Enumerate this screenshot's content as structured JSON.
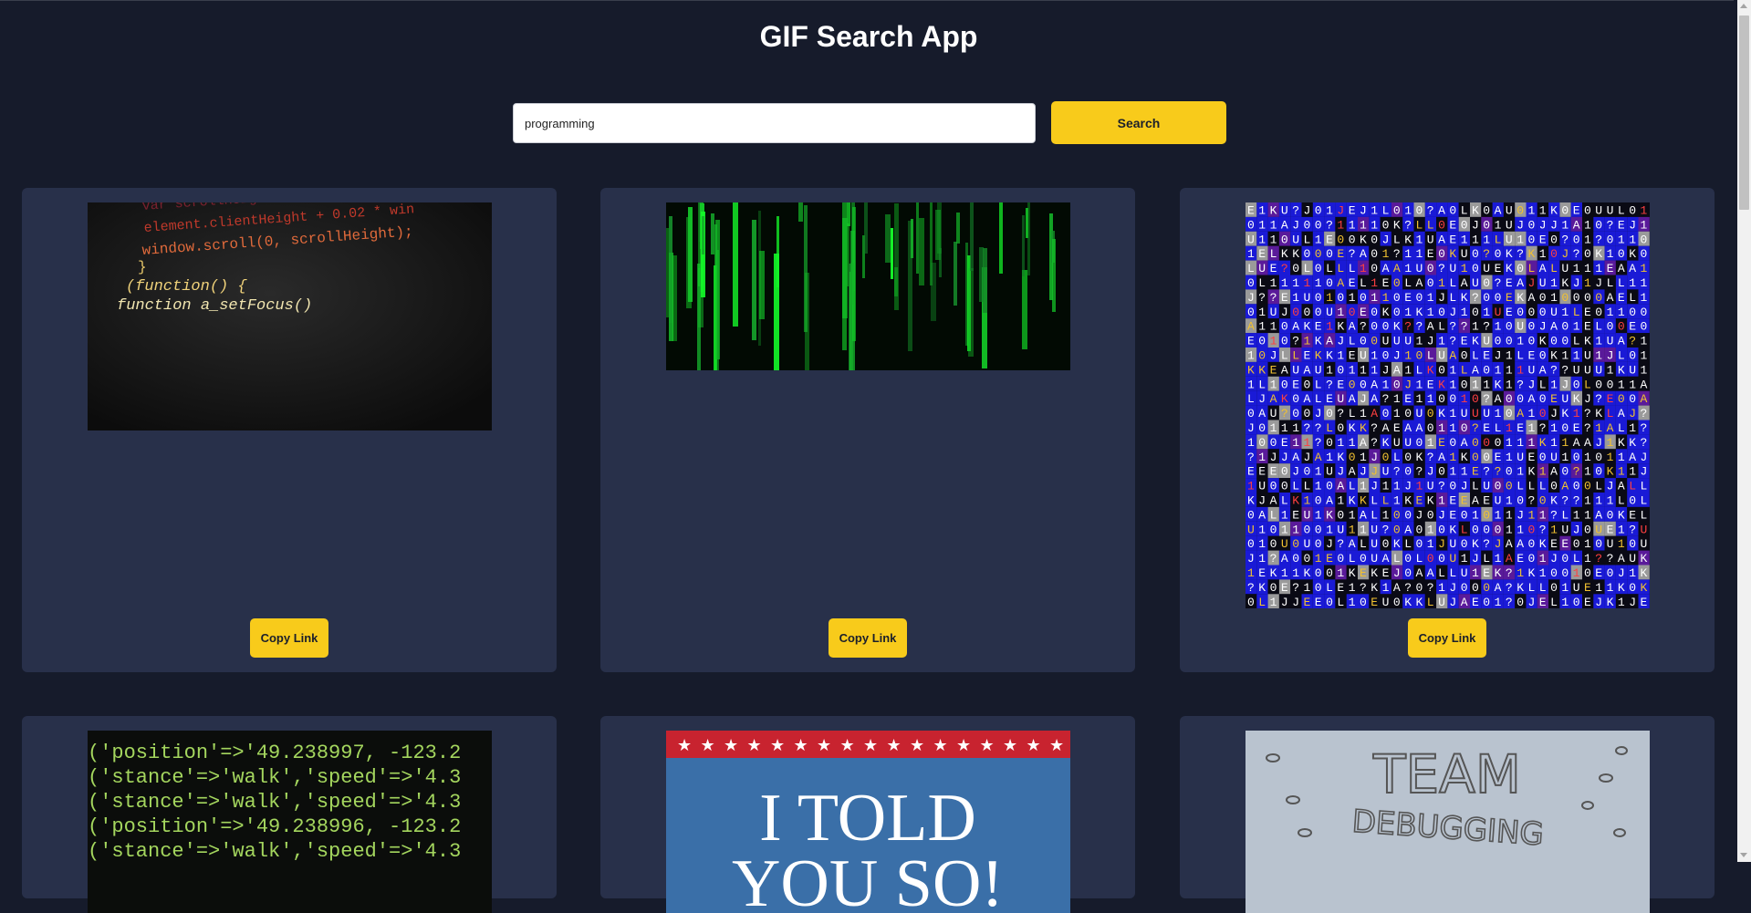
{
  "app": {
    "title": "GIF Search App"
  },
  "search": {
    "value": "programming",
    "button_label": "Search"
  },
  "results": [
    {
      "description": "code snippet gif",
      "copy_label": "Copy Link",
      "code_lines": [
        "var scrollHeight",
        "element.clientHeight + 0.02 * win",
        "window.scroll(0, scrollHeight);",
        "}",
        "(function() {",
        "function a_setFocus()"
      ]
    },
    {
      "description": "matrix code rain gif",
      "copy_label": "Copy Link"
    },
    {
      "description": "binary characters gif",
      "copy_label": "Copy Link"
    },
    {
      "description": "console log gif",
      "code_lines": [
        "('position'=>'49.238997, -123.2",
        "('stance'=>'walk','speed'=>'4.3",
        "('stance'=>'walk','speed'=>'4.3",
        "('position'=>'49.238996, -123.2",
        "('stance'=>'walk','speed'=>'4.3"
      ]
    },
    {
      "description": "i told you so gif",
      "caption_lines": [
        "I TOLD",
        "YOU SO!"
      ]
    },
    {
      "description": "team debugging gif",
      "caption_lines": [
        "TEAM",
        "DEBUGGING"
      ]
    }
  ],
  "colors": {
    "background": "#161b2b",
    "card": "#28304a",
    "accent": "#f8cb1b"
  }
}
